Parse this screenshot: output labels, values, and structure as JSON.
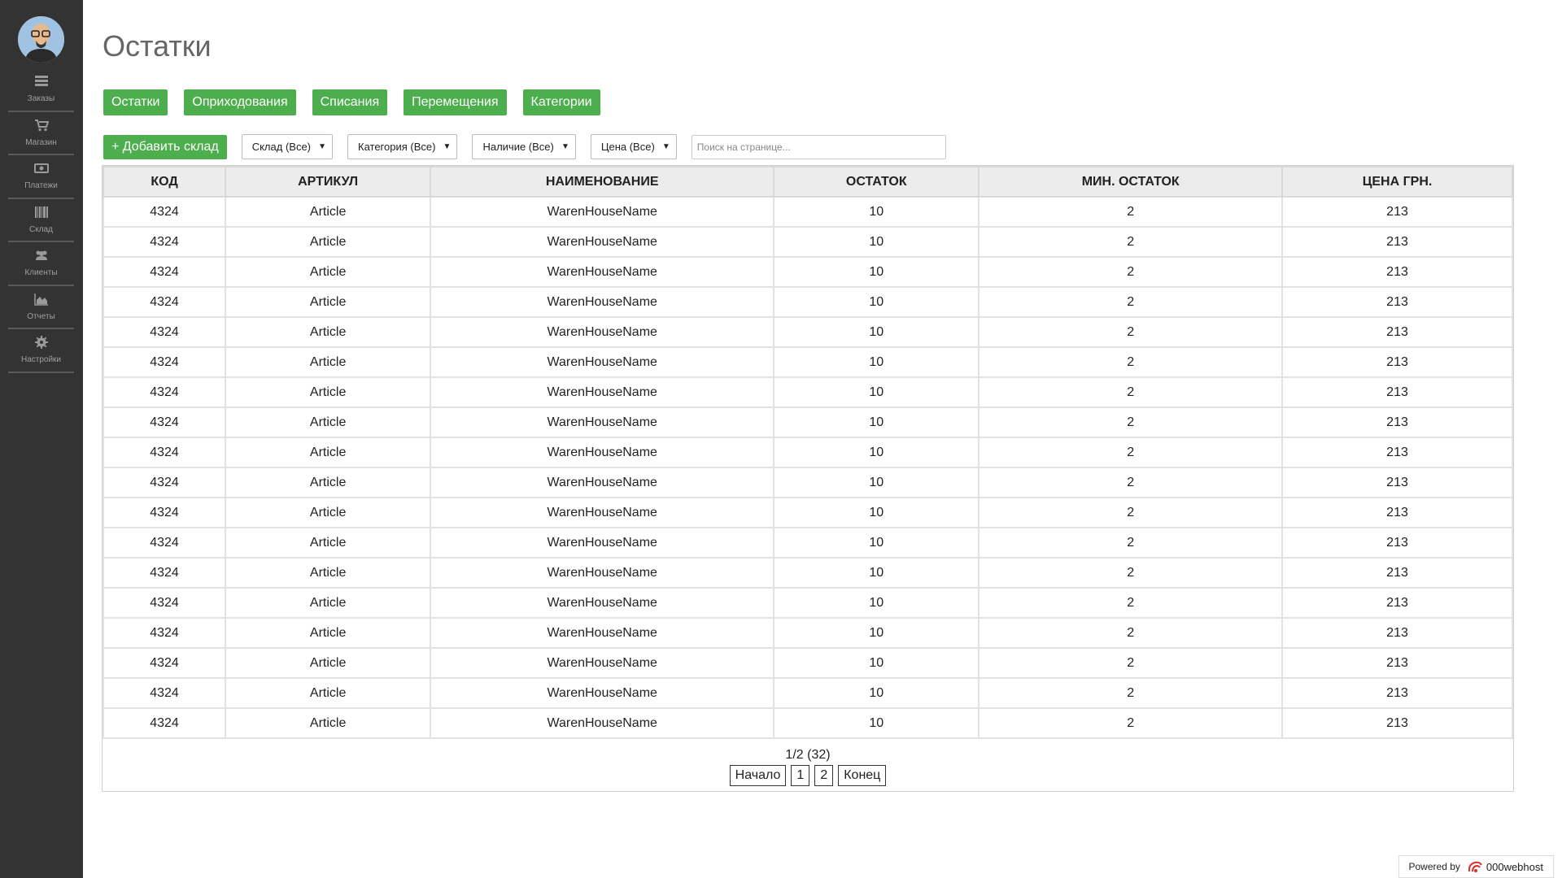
{
  "page": {
    "title": "Остатки"
  },
  "sidebar": {
    "items": [
      {
        "label": "Заказы",
        "icon": "orders-icon"
      },
      {
        "label": "Магазин",
        "icon": "cart-icon"
      },
      {
        "label": "Платежи",
        "icon": "money-icon"
      },
      {
        "label": "Склад",
        "icon": "barcode-icon"
      },
      {
        "label": "Клиенты",
        "icon": "users-icon"
      },
      {
        "label": "Отчеты",
        "icon": "area-chart-icon"
      },
      {
        "label": "Настройки",
        "icon": "gear-icon"
      }
    ]
  },
  "tabs": [
    "Остатки",
    "Оприходования",
    "Списания",
    "Перемещения",
    "Категории"
  ],
  "toolbar": {
    "add_label": "+ Добавить склад",
    "filters": [
      "Склад (Все)",
      "Категория (Все)",
      "Наличие (Все)",
      "Цена (Все)"
    ],
    "search_placeholder": "Поиск на странице..."
  },
  "table": {
    "headers": [
      "КОД",
      "АРТИКУЛ",
      "НАИМЕНОВАНИЕ",
      "ОСТАТОК",
      "МИН. ОСТАТОК",
      "ЦЕНА ГРН."
    ],
    "rows": [
      [
        "4324",
        "Article",
        "WarenHouseName",
        "10",
        "2",
        "213"
      ],
      [
        "4324",
        "Article",
        "WarenHouseName",
        "10",
        "2",
        "213"
      ],
      [
        "4324",
        "Article",
        "WarenHouseName",
        "10",
        "2",
        "213"
      ],
      [
        "4324",
        "Article",
        "WarenHouseName",
        "10",
        "2",
        "213"
      ],
      [
        "4324",
        "Article",
        "WarenHouseName",
        "10",
        "2",
        "213"
      ],
      [
        "4324",
        "Article",
        "WarenHouseName",
        "10",
        "2",
        "213"
      ],
      [
        "4324",
        "Article",
        "WarenHouseName",
        "10",
        "2",
        "213"
      ],
      [
        "4324",
        "Article",
        "WarenHouseName",
        "10",
        "2",
        "213"
      ],
      [
        "4324",
        "Article",
        "WarenHouseName",
        "10",
        "2",
        "213"
      ],
      [
        "4324",
        "Article",
        "WarenHouseName",
        "10",
        "2",
        "213"
      ],
      [
        "4324",
        "Article",
        "WarenHouseName",
        "10",
        "2",
        "213"
      ],
      [
        "4324",
        "Article",
        "WarenHouseName",
        "10",
        "2",
        "213"
      ],
      [
        "4324",
        "Article",
        "WarenHouseName",
        "10",
        "2",
        "213"
      ],
      [
        "4324",
        "Article",
        "WarenHouseName",
        "10",
        "2",
        "213"
      ],
      [
        "4324",
        "Article",
        "WarenHouseName",
        "10",
        "2",
        "213"
      ],
      [
        "4324",
        "Article",
        "WarenHouseName",
        "10",
        "2",
        "213"
      ],
      [
        "4324",
        "Article",
        "WarenHouseName",
        "10",
        "2",
        "213"
      ],
      [
        "4324",
        "Article",
        "WarenHouseName",
        "10",
        "2",
        "213"
      ]
    ]
  },
  "pager": {
    "info": "1/2 (32)",
    "first": "Начало",
    "pages": [
      "1",
      "2"
    ],
    "last": "Конец"
  },
  "footer": {
    "powered_label": "Powered by",
    "brand": "000webhost"
  },
  "colors": {
    "sidebar_bg": "#333333",
    "accent_green": "#4cae4c",
    "header_bg": "#ececec"
  }
}
